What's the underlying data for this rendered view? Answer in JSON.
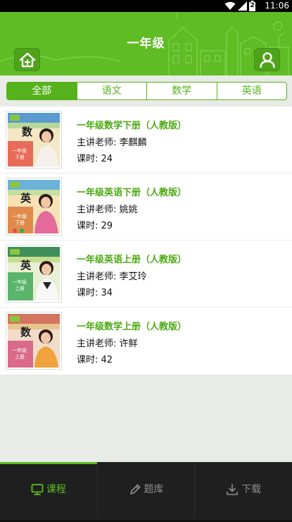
{
  "status_bar": {
    "time": "11:06",
    "battery_label": "2"
  },
  "header": {
    "title": "一年级",
    "home_icon": "home-icon",
    "user_icon": "user-icon",
    "bg_color": "#5fbc24"
  },
  "tabs": [
    {
      "label": "全部",
      "active": true
    },
    {
      "label": "语文",
      "active": false
    },
    {
      "label": "数学",
      "active": false
    },
    {
      "label": "英语",
      "active": false
    }
  ],
  "courses": [
    {
      "title": "一年级数学下册（人教版）",
      "teacher": "主讲老师: 李麒麟",
      "hours": "课时: 24",
      "cover_char": "数",
      "cover_text": "一年级 下册",
      "cover_color": "#e76b58"
    },
    {
      "title": "一年级英语下册（人教版）",
      "teacher": "主讲老师: 姚姚",
      "hours": "课时: 29",
      "cover_char": "英",
      "cover_text": "一年级 下册",
      "cover_color": "#e08b4b"
    },
    {
      "title": "一年级英语上册（人教版）",
      "teacher": "主讲老师: 李艾玲",
      "hours": "课时: 34",
      "cover_char": "英",
      "cover_text": "一年级 上册",
      "cover_color": "#5bb46b"
    },
    {
      "title": "一年级数学上册（人教版）",
      "teacher": "主讲老师: 许鲜",
      "hours": "课时: 42",
      "cover_char": "数",
      "cover_text": "一年级 上册",
      "cover_color": "#d96a8a"
    }
  ],
  "bottom_nav": [
    {
      "label": "课程",
      "icon": "monitor-icon",
      "active": true
    },
    {
      "label": "题库",
      "icon": "pencil-icon",
      "active": false
    },
    {
      "label": "下载",
      "icon": "download-icon",
      "active": false
    }
  ],
  "colors": {
    "accent": "#5fbc24",
    "course_title": "#4caa12",
    "nav_bg": "#1f1f1f"
  }
}
